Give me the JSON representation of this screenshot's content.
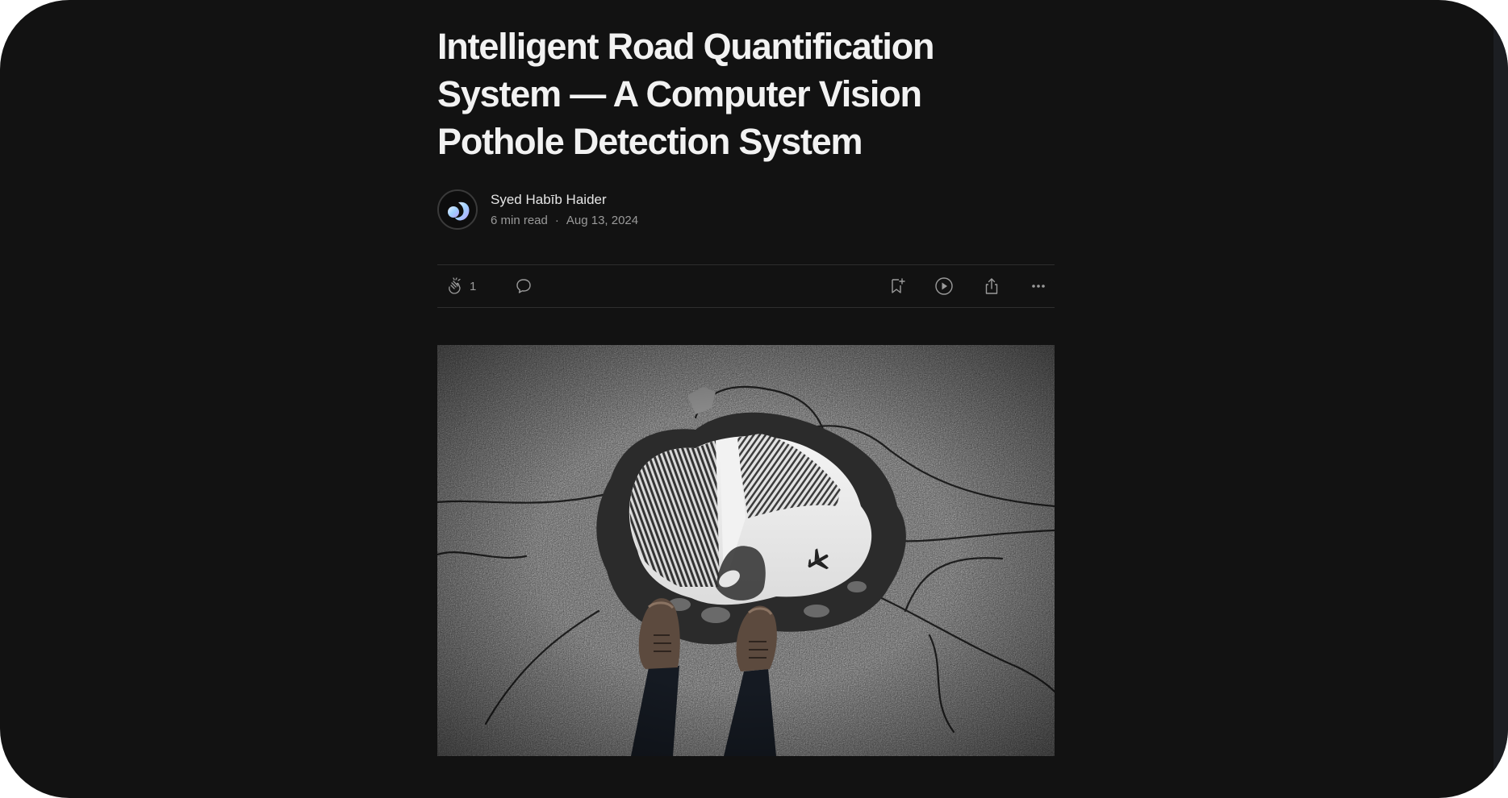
{
  "article": {
    "title": "Intelligent Road Quantification System — A Computer Vision Pothole Detection System",
    "author": {
      "name": "Syed Habīb Haider",
      "read_time": "6 min read",
      "separator": "·",
      "date": "Aug 13, 2024"
    },
    "actions": {
      "clap_count": "1",
      "icons": [
        "clap-icon",
        "comment-icon",
        "bookmark-add-icon",
        "listen-play-icon",
        "share-icon",
        "more-icon"
      ]
    },
    "hero_image": {
      "icon": "pothole-reflection-photo"
    }
  },
  "colors": {
    "background": "#121212",
    "title": "#f2f2f2",
    "meta": "#9a9a9a",
    "icon": "#9b9b9b",
    "divider": "#2e2e2e"
  }
}
